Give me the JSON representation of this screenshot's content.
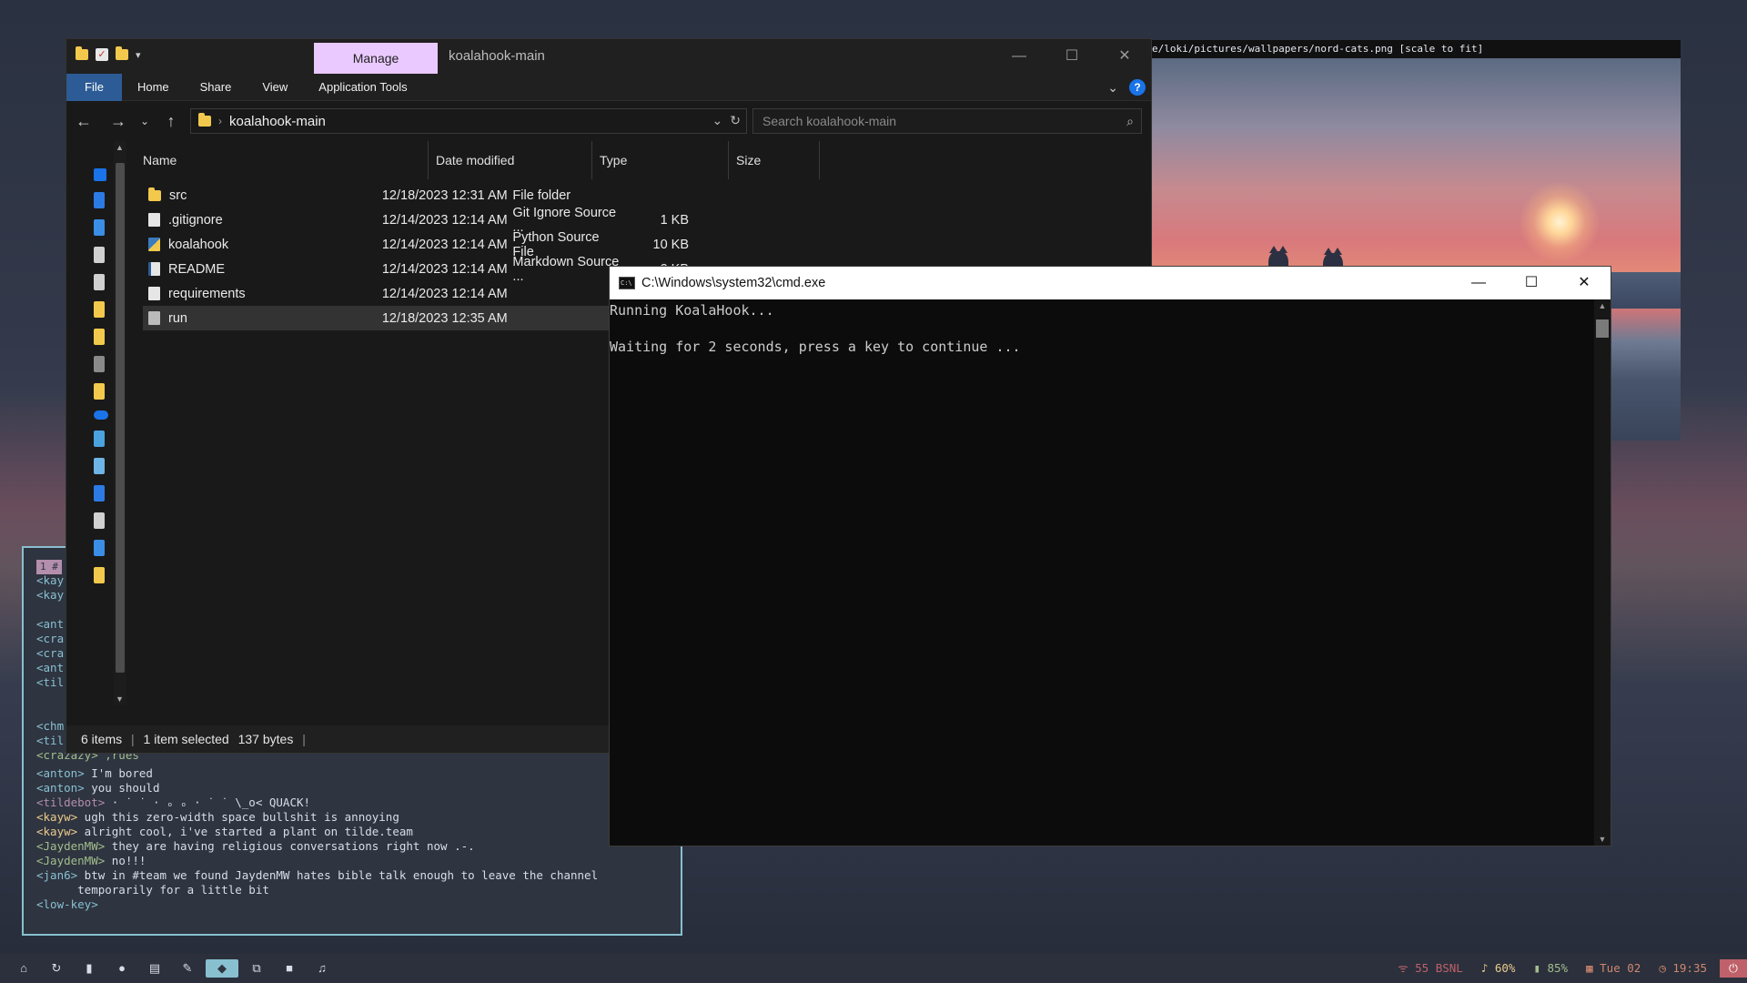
{
  "image_viewer": {
    "title": "e/loki/pictures/wallpapers/nord-cats.png [scale to fit]"
  },
  "irc": {
    "tab_number": "1 #",
    "partial_lines": [
      "<kay",
      "<kay",
      "",
      "<ant",
      "<cra",
      "<cra",
      "<ant",
      "<til",
      "",
      "",
      "<chm",
      "<til"
    ],
    "overlap_line": "<crazazy> ,rues",
    "messages": [
      {
        "nick": "<anton>",
        "text": " I'm bored"
      },
      {
        "nick": "<anton>",
        "text": " you should"
      },
      {
        "nick": "<tildebot>",
        "text": " · ˙ ˙ · ₒ ₒ · ˙ ˙ \\_o< QUACK!"
      },
      {
        "nick": "<kayw>",
        "text": " ugh this zero-width space bullshit is annoying"
      },
      {
        "nick": "<kayw>",
        "text": " alright cool, i've started a plant on tilde.team"
      },
      {
        "nick": "<JaydenMW>",
        "text": " they are having religious conversations right now .-."
      },
      {
        "nick": "<JaydenMW>",
        "text": " no!!!"
      },
      {
        "nick": "<jan6>",
        "text": " btw in #team we found JaydenMW hates bible talk enough to leave the channel"
      },
      {
        "nick": "",
        "text": "      temporarily for a little bit"
      },
      {
        "nick": "<low-key>",
        "text": ""
      }
    ]
  },
  "explorer": {
    "window_title": "koalahook-main",
    "manage_tab": "Manage",
    "ribbon_tabs": [
      "File",
      "Home",
      "Share",
      "View",
      "Application Tools"
    ],
    "address": "koalahook-main",
    "search_placeholder": "Search koalahook-main",
    "columns": [
      "Name",
      "Date modified",
      "Type",
      "Size"
    ],
    "files": [
      {
        "name": "src",
        "date": "12/18/2023 12:31 AM",
        "type": "File folder",
        "size": "",
        "icon": "folder-icon"
      },
      {
        "name": ".gitignore",
        "date": "12/14/2023 12:14 AM",
        "type": "Git Ignore Source ...",
        "size": "1 KB",
        "icon": "gitignore-file-icon"
      },
      {
        "name": "koalahook",
        "date": "12/14/2023 12:14 AM",
        "type": "Python Source File",
        "size": "10 KB",
        "icon": "python-file-icon"
      },
      {
        "name": "README",
        "date": "12/14/2023 12:14 AM",
        "type": "Markdown Source ...",
        "size": "2 KB",
        "icon": "markdown-file-icon"
      },
      {
        "name": "requirements",
        "date": "12/14/2023 12:14 AM",
        "type": "",
        "size": "",
        "icon": "text-file-icon"
      },
      {
        "name": "run",
        "date": "12/18/2023 12:35 AM",
        "type": "",
        "size": "",
        "icon": "batch-file-icon"
      }
    ],
    "status": {
      "items": "6 items",
      "selected": "1 item selected",
      "bytes": "137 bytes"
    }
  },
  "cmd": {
    "title": "C:\\Windows\\system32\\cmd.exe",
    "lines": [
      "Running KoalaHook...",
      "",
      "Waiting for 2 seconds, press a key to continue ..."
    ]
  },
  "bar": {
    "workspaces": [
      "⌂",
      "↻",
      "▮",
      "●",
      "▤",
      "✎",
      "◆",
      "⧉",
      "■",
      "♫"
    ],
    "active_workspace": 6,
    "network": "ᯤ 55 BSNL",
    "volume": "♪ 60%",
    "battery": "▮ 85%",
    "date": "▦ Tue 02",
    "clock": "◷ 19:35",
    "power": "⏻"
  }
}
